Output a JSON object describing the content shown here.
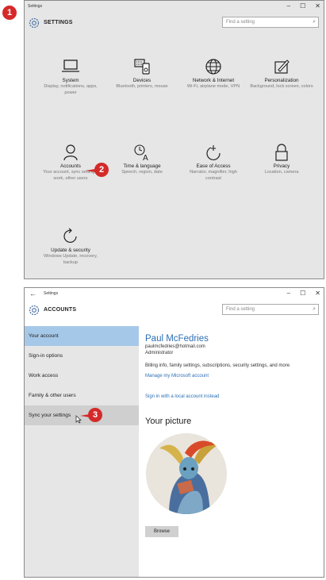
{
  "badges": {
    "b1": "1",
    "b2": "2",
    "b3": "3"
  },
  "win1": {
    "title": "Settings",
    "controls": {
      "min": "–",
      "max": "☐",
      "close": "✕"
    },
    "header": "SETTINGS",
    "search_placeholder": "Find a setting",
    "categories": [
      {
        "name": "System",
        "desc": "Display, notifications, apps, power",
        "icon": "laptop-icon"
      },
      {
        "name": "Devices",
        "desc": "Bluetooth, printers, mouse",
        "icon": "devices-icon"
      },
      {
        "name": "Network & Internet",
        "desc": "Wi-Fi, airplane mode, VPN",
        "icon": "globe-icon"
      },
      {
        "name": "Personalization",
        "desc": "Background, lock screen, colors",
        "icon": "personalization-icon"
      },
      {
        "name": "Accounts",
        "desc": "Your account, sync settings, work, other users",
        "icon": "person-icon"
      },
      {
        "name": "Time & language",
        "desc": "Speech, region, date",
        "icon": "time-language-icon"
      },
      {
        "name": "Ease of Access",
        "desc": "Narrator, magnifier, high contrast",
        "icon": "ease-of-access-icon"
      },
      {
        "name": "Privacy",
        "desc": "Location, camera",
        "icon": "lock-icon"
      },
      {
        "name": "Update & security",
        "desc": "Windows Update, recovery, backup",
        "icon": "update-icon"
      }
    ]
  },
  "win2": {
    "title": "Settings",
    "back": "←",
    "controls": {
      "min": "–",
      "max": "☐",
      "close": "✕"
    },
    "header": "ACCOUNTS",
    "search_placeholder": "Find a setting",
    "sidebar": [
      "Your account",
      "Sign-in options",
      "Work access",
      "Family & other users",
      "Sync your settings"
    ],
    "user": {
      "name": "Paul McFedries",
      "email": "paulmcfedries@hotmail.com",
      "role": "Administrator"
    },
    "billing": "Billing info, family settings, subscriptions, security settings, and more",
    "manage_link": "Manage my Microsoft account",
    "local_link": "Sign in with a local account instead",
    "picture_title": "Your picture",
    "browse": "Browse"
  }
}
